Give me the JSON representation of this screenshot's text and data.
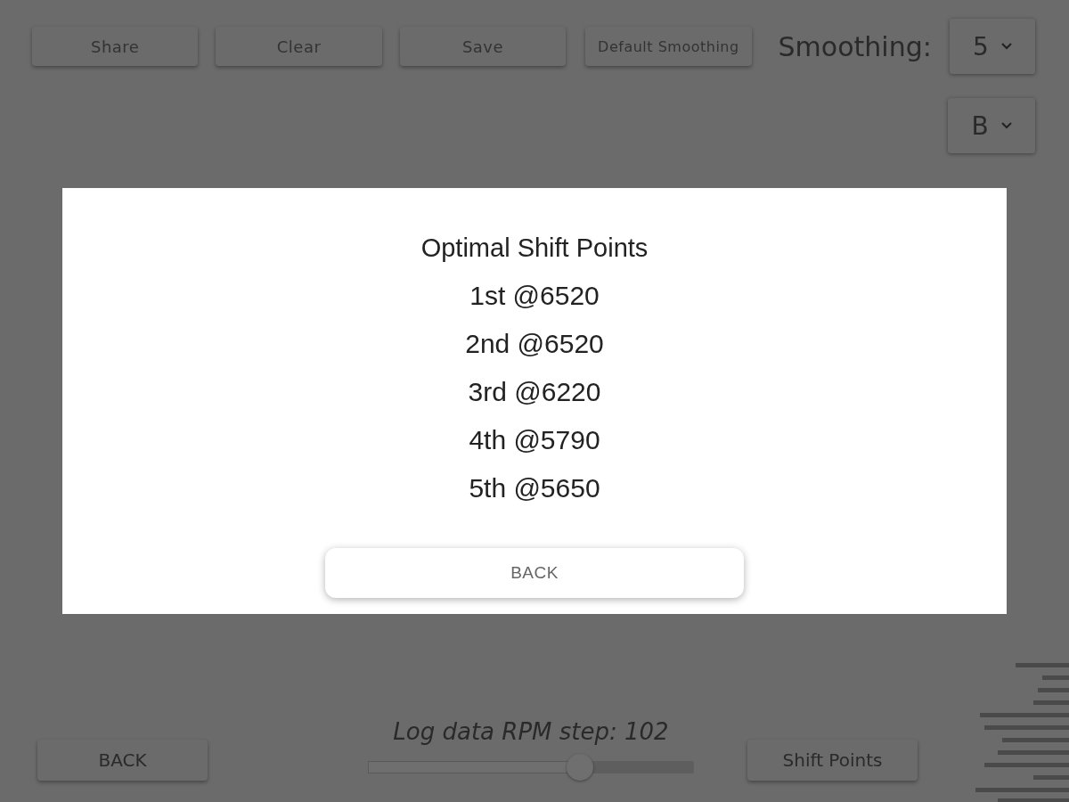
{
  "toolbar": {
    "buttons": [
      "Share",
      "Clear",
      "Save",
      "Default Smoothing"
    ],
    "smoothing_label": "Smoothing:",
    "smoothing_value": "5",
    "gear_value": "B"
  },
  "bottom": {
    "back": "BACK",
    "step_label": "Log data RPM step: 102",
    "slider": {
      "level": 0.65
    },
    "shift_points": "Shift Points"
  },
  "dialog": {
    "title": "Optimal Shift Points",
    "lines": [
      "1st @6520",
      "2nd @6520",
      "3rd @6220",
      "4th @5790",
      "5th @5650"
    ],
    "button": "BACK"
  }
}
